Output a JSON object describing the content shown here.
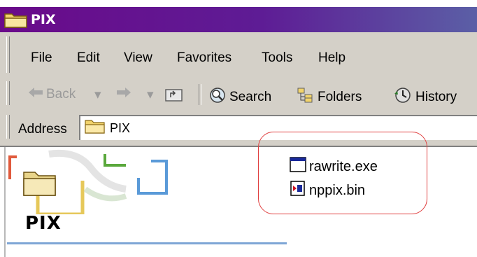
{
  "window": {
    "title": "PIX"
  },
  "menu": {
    "items": [
      "File",
      "Edit",
      "View",
      "Favorites",
      "Tools",
      "Help"
    ]
  },
  "toolbar": {
    "back_label": "Back",
    "search_label": "Search",
    "folders_label": "Folders",
    "history_label": "History"
  },
  "address": {
    "label": "Address",
    "value": "PIX"
  },
  "folder_pane": {
    "heading": "PIX"
  },
  "files": [
    {
      "name": "rawrite.exe",
      "icon": "application-window-icon"
    },
    {
      "name": "nppix.bin",
      "icon": "binary-file-icon"
    }
  ],
  "colors": {
    "title_bar_start": "#6a0a8a",
    "title_bar_end": "#5b5fa6",
    "highlight": "#e04040",
    "chrome": "#d4d0c8"
  }
}
